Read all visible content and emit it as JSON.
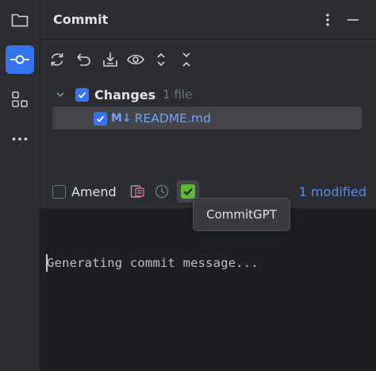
{
  "toolstrip": {
    "items": [
      {
        "icon": "project-folder-icon"
      },
      {
        "icon": "commit-icon",
        "active": true
      },
      {
        "icon": "structure-icon"
      },
      {
        "icon": "more-icon"
      }
    ]
  },
  "panel": {
    "title": "Commit",
    "toolbar": [
      {
        "icon": "refresh-icon"
      },
      {
        "icon": "rollback-icon"
      },
      {
        "icon": "shelve-icon"
      },
      {
        "icon": "show-diff-icon"
      },
      {
        "icon": "expand-all-icon"
      },
      {
        "icon": "collapse-all-icon"
      }
    ],
    "changes": {
      "label": "Changes",
      "count": "1 file",
      "files": [
        {
          "badge": "M↓",
          "name": "README.md"
        }
      ]
    },
    "amend_label": "Amend",
    "modified_link": "1 modified"
  },
  "editor": {
    "text": "Generating commit message..."
  },
  "tooltip": {
    "text": "CommitGPT"
  },
  "colors": {
    "accent": "#3574f0",
    "panel_bg": "#2b2d30",
    "editor_bg": "#1e1f22",
    "link": "#548af7",
    "commitgpt_green": "#5fb832"
  }
}
